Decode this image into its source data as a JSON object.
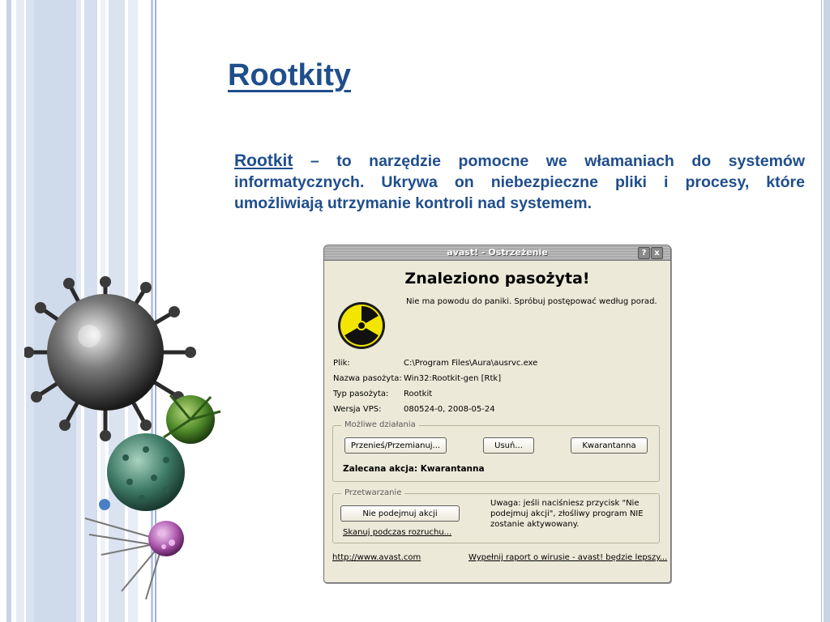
{
  "slide": {
    "title": "Rootkity",
    "term": "Rootkit",
    "definition": " – to  narzędzie pomocne we włamaniach do systemów informatycznych. Ukrywa on niebezpieczne pliki i procesy, które umożliwiają utrzymanie kontroli nad systemem."
  },
  "dialog": {
    "title": "avast! - Ostrzeżenie",
    "help_btn": "?",
    "close_btn": "x",
    "heading": "Znaleziono pasożyta!",
    "subtitle": "Nie ma powodu do paniki. Spróbuj postępować według porad.",
    "info": [
      {
        "label": "Plik:",
        "value": "C:\\Program Files\\Aura\\ausrvc.exe"
      },
      {
        "label": "Nazwa pasożyta:",
        "value": "Win32:Rootkit-gen [Rtk]"
      },
      {
        "label": "Typ pasożyta:",
        "value": "Rootkit"
      },
      {
        "label": "Wersja VPS:",
        "value": "080524-0, 2008-05-24"
      }
    ],
    "actions": {
      "legend": "Możliwe działania",
      "move_btn": "Przenieś/Przemianuj...",
      "delete_btn": "Usuń...",
      "quarantine_btn": "Kwarantanna",
      "recommended": "Zalecana akcja: Kwarantanna"
    },
    "processing": {
      "legend": "Przetwarzanie",
      "no_action_btn": "Nie podejmuj akcji",
      "scan_link": "Skanuj podczas rozruchu...",
      "note": "Uwaga: jeśli naciśniesz przycisk \"Nie podejmuj akcji\", złośliwy program NIE zostanie aktywowany."
    },
    "footer": {
      "site_link": "http://www.avast.com",
      "report_link": "Wypełnij raport o wirusie - avast! będzie lepszy..."
    }
  },
  "colors": {
    "accent": "#1f4e8c",
    "dialog_bg": "#ece9d8",
    "stripe_light": "#dbe3f0",
    "stripe_mid": "#b9c8e0",
    "bullet": "#4a7fc7"
  },
  "icons": [
    "radiation-icon",
    "virus-illustration"
  ]
}
